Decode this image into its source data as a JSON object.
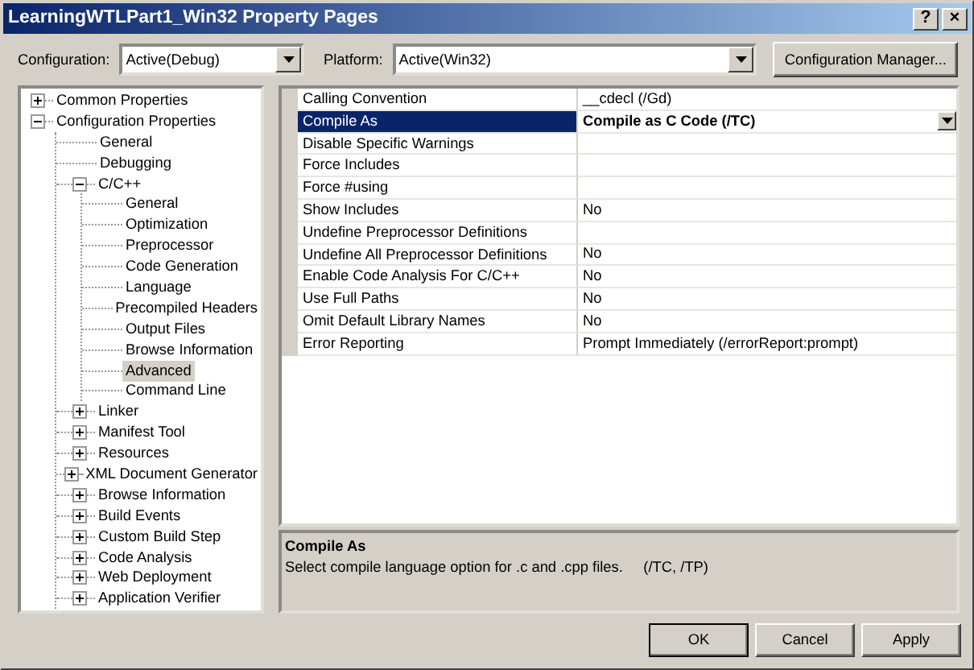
{
  "window": {
    "title": "LearningWTLPart1_Win32 Property Pages",
    "help_button": "?",
    "close_button": "×"
  },
  "toolbar": {
    "configuration": {
      "label": "Configuration:",
      "value": "Active(Debug)"
    },
    "platform": {
      "label": "Platform:",
      "value": "Active(Win32)"
    },
    "manager_button": "Configuration Manager..."
  },
  "tree": [
    {
      "label": "Common Properties",
      "expanded": false,
      "selected": false
    },
    {
      "label": "Configuration Properties",
      "expanded": true,
      "selected": false,
      "children": [
        {
          "label": "General",
          "selected": false
        },
        {
          "label": "Debugging",
          "selected": false
        },
        {
          "label": "C/C++",
          "expanded": true,
          "selected": false,
          "children": [
            {
              "label": "General",
              "selected": false
            },
            {
              "label": "Optimization",
              "selected": false
            },
            {
              "label": "Preprocessor",
              "selected": false
            },
            {
              "label": "Code Generation",
              "selected": false
            },
            {
              "label": "Language",
              "selected": false
            },
            {
              "label": "Precompiled Headers",
              "selected": false
            },
            {
              "label": "Output Files",
              "selected": false
            },
            {
              "label": "Browse Information",
              "selected": false
            },
            {
              "label": "Advanced",
              "selected": true
            },
            {
              "label": "Command Line",
              "selected": false
            }
          ]
        },
        {
          "label": "Linker",
          "expanded": false,
          "selected": false
        },
        {
          "label": "Manifest Tool",
          "expanded": false,
          "selected": false
        },
        {
          "label": "Resources",
          "expanded": false,
          "selected": false
        },
        {
          "label": "XML Document Generator",
          "expanded": false,
          "selected": false
        },
        {
          "label": "Browse Information",
          "expanded": false,
          "selected": false
        },
        {
          "label": "Build Events",
          "expanded": false,
          "selected": false
        },
        {
          "label": "Custom Build Step",
          "expanded": false,
          "selected": false
        },
        {
          "label": "Code Analysis",
          "expanded": false,
          "selected": false
        },
        {
          "label": "Web Deployment",
          "expanded": false,
          "selected": false
        },
        {
          "label": "Application Verifier",
          "expanded": false,
          "selected": false
        }
      ]
    }
  ],
  "grid": {
    "rows": [
      {
        "name": "Calling Convention",
        "value": "__cdecl (/Gd)",
        "selected": false
      },
      {
        "name": "Compile As",
        "value": "Compile as C Code (/TC)",
        "selected": true
      },
      {
        "name": "Disable Specific Warnings",
        "selected": false
      },
      {
        "name": "Force Includes",
        "selected": false
      },
      {
        "name": "Force #using",
        "selected": false
      },
      {
        "name": "Show Includes",
        "value": "No",
        "selected": false
      },
      {
        "name": "Undefine Preprocessor Definitions",
        "selected": false
      },
      {
        "name": "Undefine All Preprocessor Definitions",
        "value": "No",
        "selected": false
      },
      {
        "name": "Enable Code Analysis For C/C++",
        "value": "No",
        "selected": false
      },
      {
        "name": "Use Full Paths",
        "value": "No",
        "selected": false
      },
      {
        "name": "Omit Default Library Names",
        "value": "No",
        "selected": false
      },
      {
        "name": "Error Reporting",
        "value": "Prompt Immediately (/errorReport:prompt)",
        "selected": false
      }
    ]
  },
  "description": {
    "title": "Compile As",
    "text": "Select compile language option for .c and .cpp files.     (/TC, /TP)"
  },
  "buttons": [
    {
      "label": "OK",
      "default": true
    },
    {
      "label": "Cancel",
      "default": false
    },
    {
      "label": "Apply",
      "default": false
    }
  ]
}
